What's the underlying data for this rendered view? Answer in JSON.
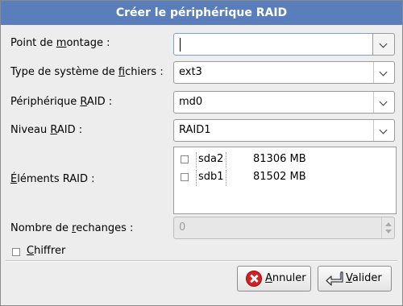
{
  "dialog": {
    "title": "Créer le périphérique RAID"
  },
  "form": {
    "mount_point": {
      "label_pre": "Point de ",
      "label_u": "m",
      "label_post": "ontage :",
      "value": ""
    },
    "fs_type": {
      "label_pre": "Type de système de ",
      "label_u": "f",
      "label_post": "ichiers :",
      "value": "ext3"
    },
    "raid_device": {
      "label_pre": "Périphérique ",
      "label_u": "R",
      "label_post": "AID :",
      "value": "md0"
    },
    "raid_level": {
      "label_pre": "Niveau ",
      "label_u": "R",
      "label_post": "AID :",
      "value": "RAID1"
    },
    "raid_members": {
      "label_pre": "",
      "label_u": "É",
      "label_post": "léments RAID :",
      "items": [
        {
          "device": "sda2",
          "size": "81306 MB",
          "checked": false
        },
        {
          "device": "sdb1",
          "size": "81502 MB",
          "checked": false
        }
      ]
    },
    "spares": {
      "label_pre": "Nombre de ",
      "label_u": "r",
      "label_post": "echanges :",
      "value": "0"
    },
    "encrypt": {
      "label_u": "C",
      "label_post": "hiffrer",
      "checked": false
    }
  },
  "buttons": {
    "cancel": {
      "label_u": "A",
      "label_post": "nnuler"
    },
    "ok": {
      "label_u": "V",
      "label_post": "alider"
    }
  }
}
